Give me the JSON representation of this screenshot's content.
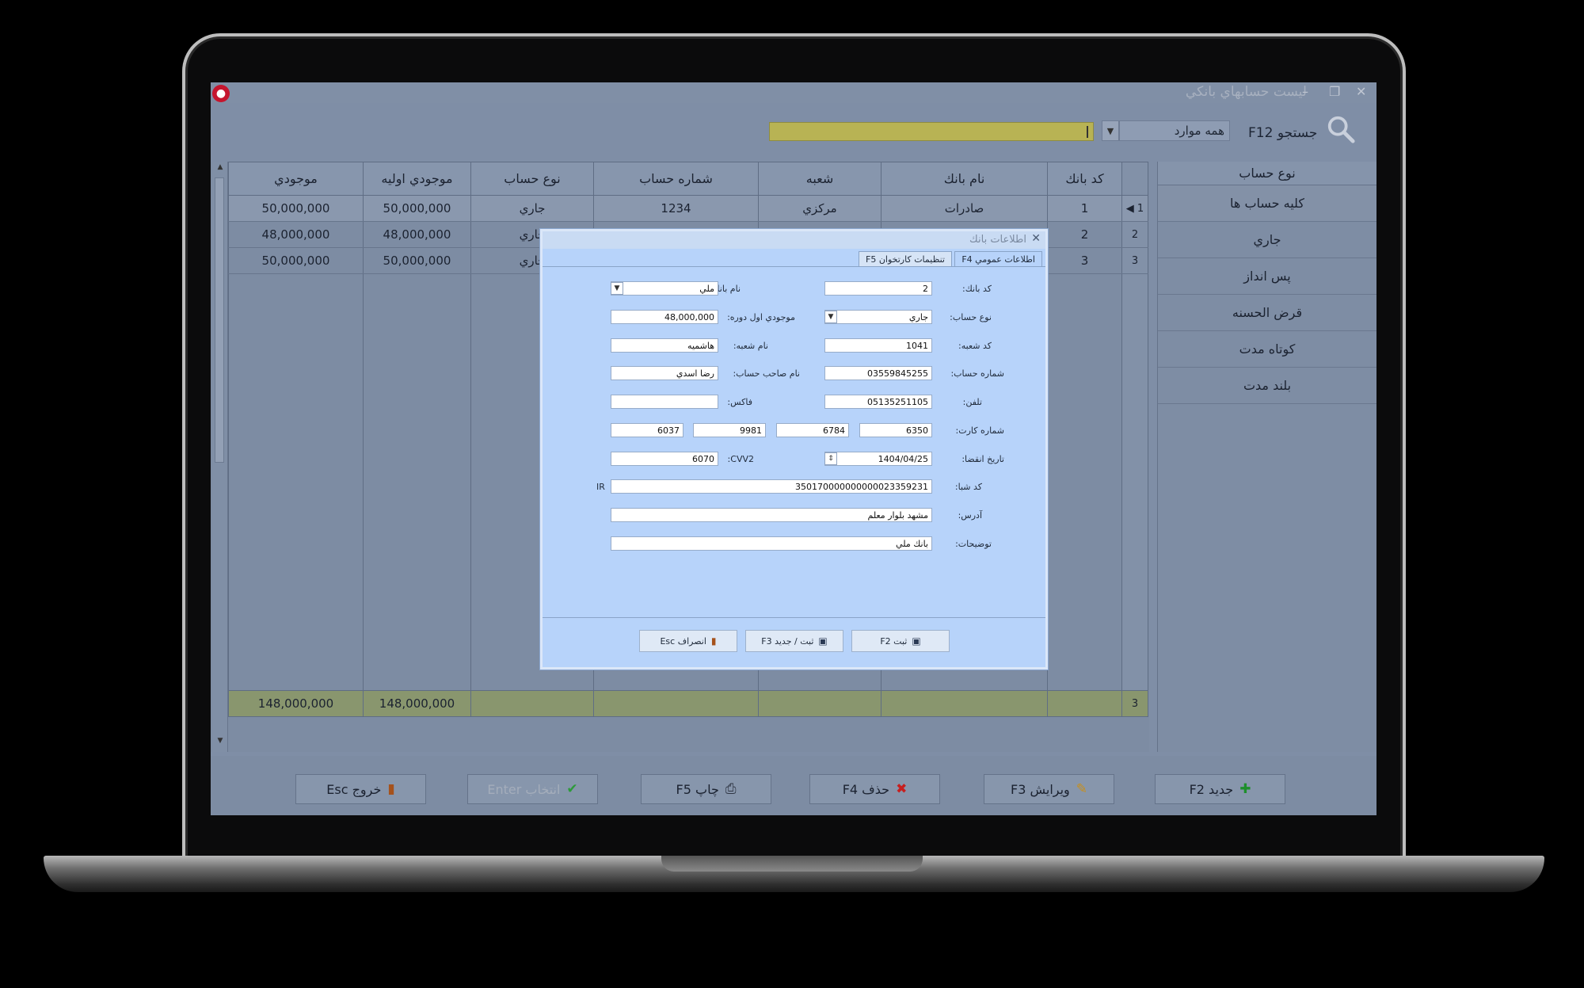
{
  "window": {
    "title": "ليست حسابهاي بانكي",
    "app_icon": "app-logo-icon",
    "controls": [
      "–",
      "❐",
      "✕"
    ]
  },
  "search": {
    "label": "جستجو F12",
    "scope": "همه موارد",
    "query": ""
  },
  "grid": {
    "columns": [
      "كد بانك",
      "نام بانك",
      "شعبه",
      "شماره حساب",
      "نوع حساب",
      "موجودي اوليه",
      "موجودي"
    ],
    "rows": [
      {
        "num": "1",
        "code": "1",
        "bank": "صادرات",
        "branch": "مركزي",
        "account": "1234",
        "type": "جاري",
        "initial": "50,000,000",
        "balance": "50,000,000"
      },
      {
        "num": "2",
        "code": "2",
        "bank": "",
        "branch": "",
        "account": "",
        "type": "جاري",
        "initial": "48,000,000",
        "balance": "48,000,000"
      },
      {
        "num": "3",
        "code": "3",
        "bank": "",
        "branch": "",
        "account": "",
        "type": "جاري",
        "initial": "50,000,000",
        "balance": "50,000,000"
      }
    ],
    "total": {
      "count": "3",
      "initial": "148,000,000",
      "balance": "148,000,000"
    }
  },
  "categories": {
    "header": "نوع حساب",
    "items": [
      "كليه حساب ها",
      "جاري",
      "پس انداز",
      "قرض الحسنه",
      "كوتاه مدت",
      "بلند مدت"
    ]
  },
  "toolbar": {
    "new": "جديد F2",
    "edit": "ويرايش F3",
    "delete": "حذف F4",
    "print": "چاپ F5",
    "select": "انتخاب Enter",
    "exit": "خروج Esc"
  },
  "dialog": {
    "title": "اطلاعات بانك",
    "tabs": {
      "general": "اطلاعات عمومي F4",
      "card_reader": "تنظيمات كارتخوان F5"
    },
    "labels": {
      "bank_code": "كد بانك:",
      "bank_name": "نام بانك:",
      "account_type": "نوع حساب:",
      "opening_balance": "موجودي اول دوره:",
      "branch_code": "كد شعبه:",
      "branch_name": "نام شعبه:",
      "account_number": "شماره حساب:",
      "account_holder": "نام صاحب حساب:",
      "phone": "تلفن:",
      "fax": "فاكس:",
      "card_number": "شماره كارت:",
      "expiry": "تاريخ انقضا:",
      "cvv2": "CVV2:",
      "sheba": "كد شبا:",
      "address": "آدرس:",
      "description": "توضيحات:"
    },
    "values": {
      "bank_code": "2",
      "bank_name": "ملي",
      "account_type": "جاري",
      "opening_balance": "48,000,000",
      "branch_code": "1041",
      "branch_name": "هاشميه",
      "account_number": "03559845255",
      "account_holder": "رضا اسدي",
      "phone": "05135251105",
      "fax": "",
      "card_1": "6350",
      "card_2": "6784",
      "card_3": "9981",
      "card_4": "6037",
      "expiry": "1404/04/25",
      "cvv2": "6070",
      "sheba": "350170000000000023359231",
      "sheba_prefix": "IR",
      "address": "مشهد بلوار معلم",
      "description": "بانك ملي"
    },
    "buttons": {
      "save": "ثبت F2",
      "save_new": "ثبت / جديد F3",
      "cancel": "انصراف Esc"
    }
  }
}
